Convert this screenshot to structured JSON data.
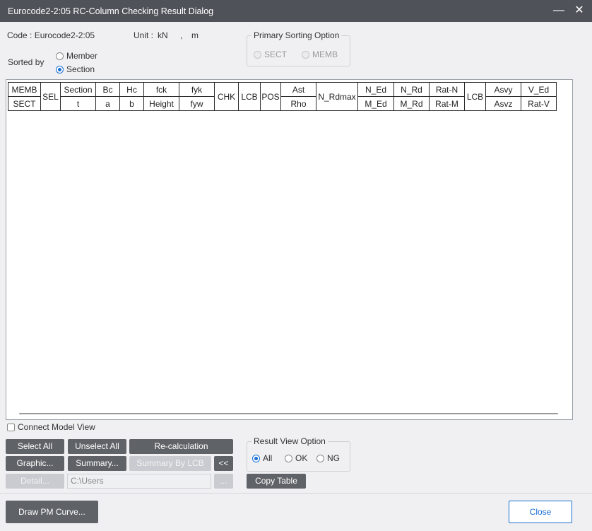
{
  "window": {
    "title": "Eurocode2-2:05 RC-Column Checking Result Dialog",
    "minimize_glyph": "—",
    "close_glyph": "✕"
  },
  "info": {
    "code_label": "Code : Eurocode2-2:05",
    "unit_label": "Unit :",
    "unit_force": "kN",
    "unit_sep": ",",
    "unit_length": "m"
  },
  "sorted_by": {
    "label": "Sorted by",
    "options": [
      {
        "label": "Member",
        "selected": false
      },
      {
        "label": "Section",
        "selected": true
      }
    ]
  },
  "primary_sorting": {
    "title": "Primary Sorting Option",
    "options": [
      {
        "label": "SECT",
        "selected": false,
        "enabled": false
      },
      {
        "label": "MEMB",
        "selected": false,
        "enabled": false
      }
    ]
  },
  "table": {
    "header_row1": [
      "MEMB",
      "SEL",
      "Section",
      "Bc",
      "Hc",
      "fck",
      "fyk",
      "CHK",
      "LCB",
      "POS",
      "Ast",
      "N_Rdmax",
      "N_Ed",
      "N_Rd",
      "Rat-N",
      "LCB",
      "Asvy",
      "V_Ed"
    ],
    "header_row2": [
      "SECT",
      "t",
      "a",
      "b",
      "Height",
      "fyw",
      "Rho",
      "M_Ed",
      "M_Rd",
      "Rat-M",
      "Asvz",
      "Rat-V"
    ],
    "rows": []
  },
  "connect_model_view": {
    "label": "Connect Model View",
    "checked": false
  },
  "buttons": {
    "select_all": "Select All",
    "unselect_all": "Unselect All",
    "recalculation": "Re-calculation",
    "graphic": "Graphic...",
    "summary": "Summary...",
    "summary_by_lcb": "Summary By LCB",
    "collapse": "<<",
    "detail": "Detail...",
    "browse": "...",
    "copy_table": "Copy Table",
    "draw_pm_curve": "Draw PM Curve...",
    "close": "Close"
  },
  "path": {
    "value": "C:\\Users"
  },
  "result_view": {
    "title": "Result View Option",
    "options": [
      {
        "label": "All",
        "selected": true
      },
      {
        "label": "OK",
        "selected": false
      },
      {
        "label": "NG",
        "selected": false
      }
    ]
  },
  "colors": {
    "titlebar": "#4f5359",
    "button": "#5f6368",
    "accent": "#1a6fd1"
  }
}
